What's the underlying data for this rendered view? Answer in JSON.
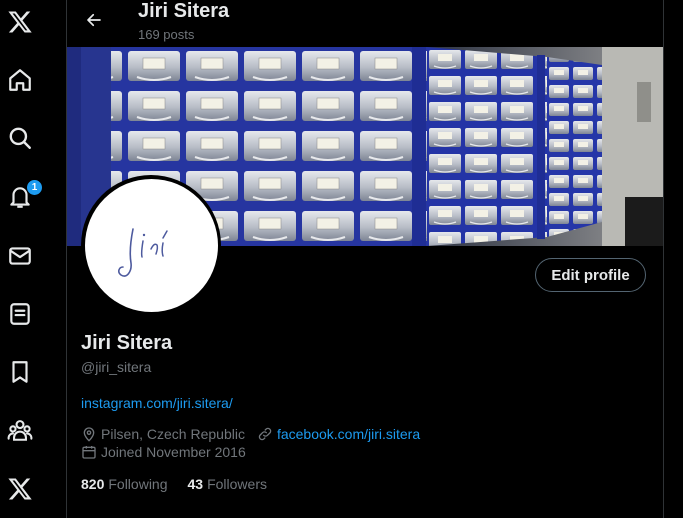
{
  "nav": {
    "notification_count": "1"
  },
  "header": {
    "title": "Jiri Sitera",
    "posts": "169 posts"
  },
  "profile": {
    "name": "Jiri Sitera",
    "handle": "@jiri_sitera",
    "bio_link": "instagram.com/jiri.sitera/",
    "location": "Pilsen, Czech Republic",
    "website": "facebook.com/jiri.sitera",
    "joined": "Joined November 2016",
    "following_count": "820",
    "following_label": "Following",
    "followers_count": "43",
    "followers_label": "Followers",
    "edit_label": "Edit profile",
    "avatar_signature": "Jiří"
  },
  "colors": {
    "accent": "#1d9bf0",
    "bg": "#000000",
    "text": "#e7e9ea",
    "muted": "#71767b",
    "banner_frame": "#2a3aa8"
  }
}
